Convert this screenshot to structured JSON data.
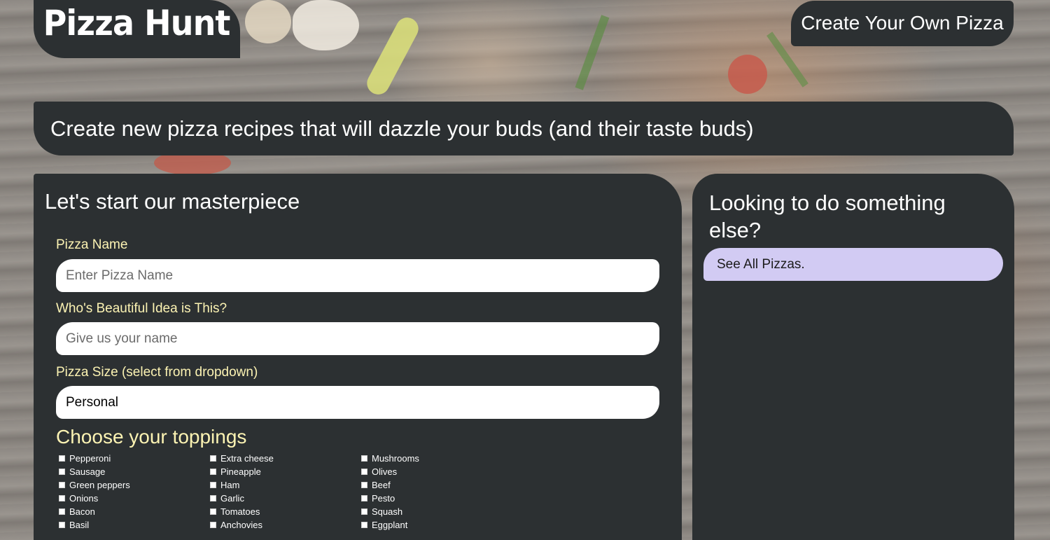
{
  "header": {
    "logo": "Pizza Hunt",
    "create_button": "Create Your Own Pizza"
  },
  "tagline": "Create new pizza recipes that will dazzle your buds (and their taste buds)",
  "form": {
    "title": "Let's start our masterpiece",
    "pizza_name_label": "Pizza Name",
    "pizza_name_placeholder": "Enter Pizza Name",
    "creator_label": "Who's Beautiful Idea is This?",
    "creator_placeholder": "Give us your name",
    "size_label": "Pizza Size (select from dropdown)",
    "size_value": "Personal",
    "toppings_title": "Choose your toppings",
    "toppings": [
      [
        "Pepperoni",
        "Sausage",
        "Green peppers",
        "Onions",
        "Bacon",
        "Basil"
      ],
      [
        "Extra cheese",
        "Pineapple",
        "Ham",
        "Garlic",
        "Tomatoes",
        "Anchovies"
      ],
      [
        "Mushrooms",
        "Olives",
        "Beef",
        "Pesto",
        "Squash",
        "Eggplant"
      ]
    ]
  },
  "sidebar": {
    "title": "Looking to do something else?",
    "see_all_link": "See All Pizzas."
  },
  "colors": {
    "panel": "#2c3032",
    "label_yellow": "#fcf3b3",
    "link_lavender": "#d2cbf3"
  }
}
